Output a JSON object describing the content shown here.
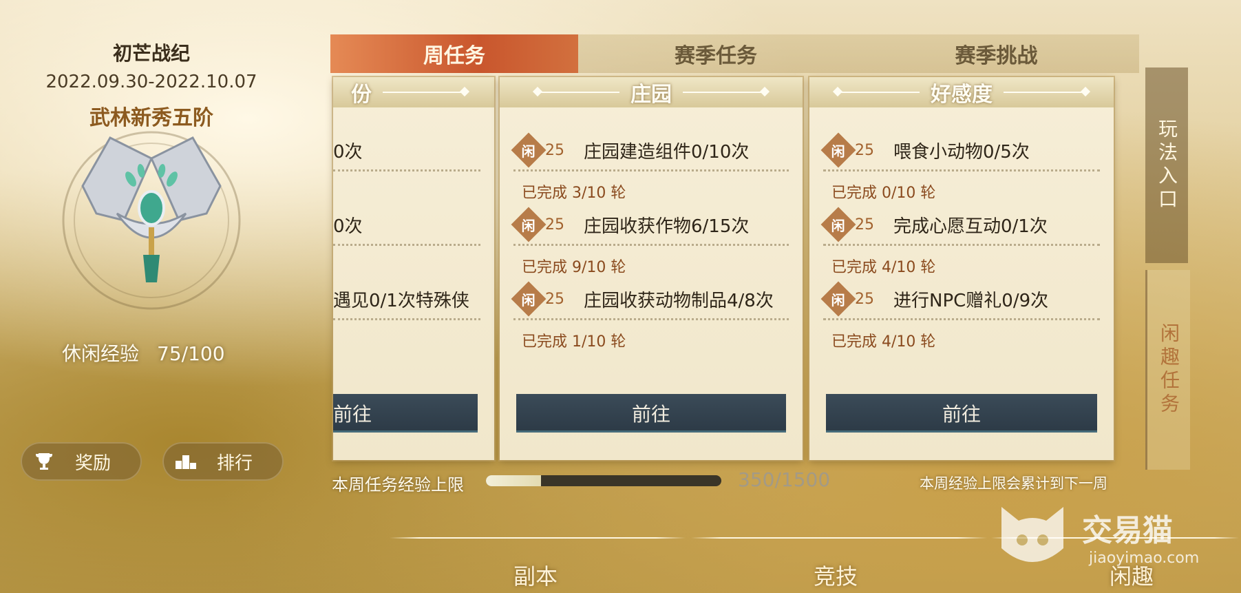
{
  "season": {
    "title": "初芒战纪",
    "dates": "2022.09.30-2022.10.07",
    "rank": "武林新秀五阶",
    "exp_label": "休闲经验",
    "exp_value": "75/100",
    "reward_label": "奖励",
    "rank_label": "排行"
  },
  "tabs": [
    "周任务",
    "赛季任务",
    "赛季挑战"
  ],
  "cards": [
    {
      "title": "份",
      "tasks": [
        {
          "name": "0次",
          "progress": ""
        },
        {
          "name": "0次",
          "progress": ""
        },
        {
          "name": "遇见0/1次特殊侠",
          "progress": ""
        }
      ],
      "button": "前往"
    },
    {
      "title": "庄园",
      "tasks": [
        {
          "points": "25",
          "name": "庄园建造组件0/10次",
          "progress": "已完成 3/10 轮"
        },
        {
          "points": "25",
          "name": "庄园收获作物6/15次",
          "progress": "已完成 9/10 轮"
        },
        {
          "points": "25",
          "name": "庄园收获动物制品4/8次",
          "progress": "已完成 1/10 轮"
        }
      ],
      "button": "前往"
    },
    {
      "title": "好感度",
      "tasks": [
        {
          "points": "25",
          "name": "喂食小动物0/5次",
          "progress": "已完成 0/10 轮"
        },
        {
          "points": "25",
          "name": "完成心愿互动0/1次",
          "progress": "已完成 4/10 轮"
        },
        {
          "points": "25",
          "name": "进行NPC赠礼0/9次",
          "progress": "已完成 4/10 轮"
        }
      ],
      "button": "前往"
    }
  ],
  "badge_char": "闲",
  "weekly": {
    "label": "本周任务经验上限",
    "value": "350/1500",
    "fraction": 0.2333,
    "note": "本周经验上限会累计到下一周"
  },
  "side_tabs": {
    "play": "玩法入口",
    "leisure": "闲趣任务"
  },
  "bottom_nav": [
    "副本",
    "竞技",
    "闲趣"
  ],
  "watermark": {
    "brand": "交易猫",
    "url": "jiaoyimao.com"
  },
  "colors": {
    "active_tab": "#d2703e",
    "button": "#2c3a46",
    "card": "#f3ead0"
  }
}
